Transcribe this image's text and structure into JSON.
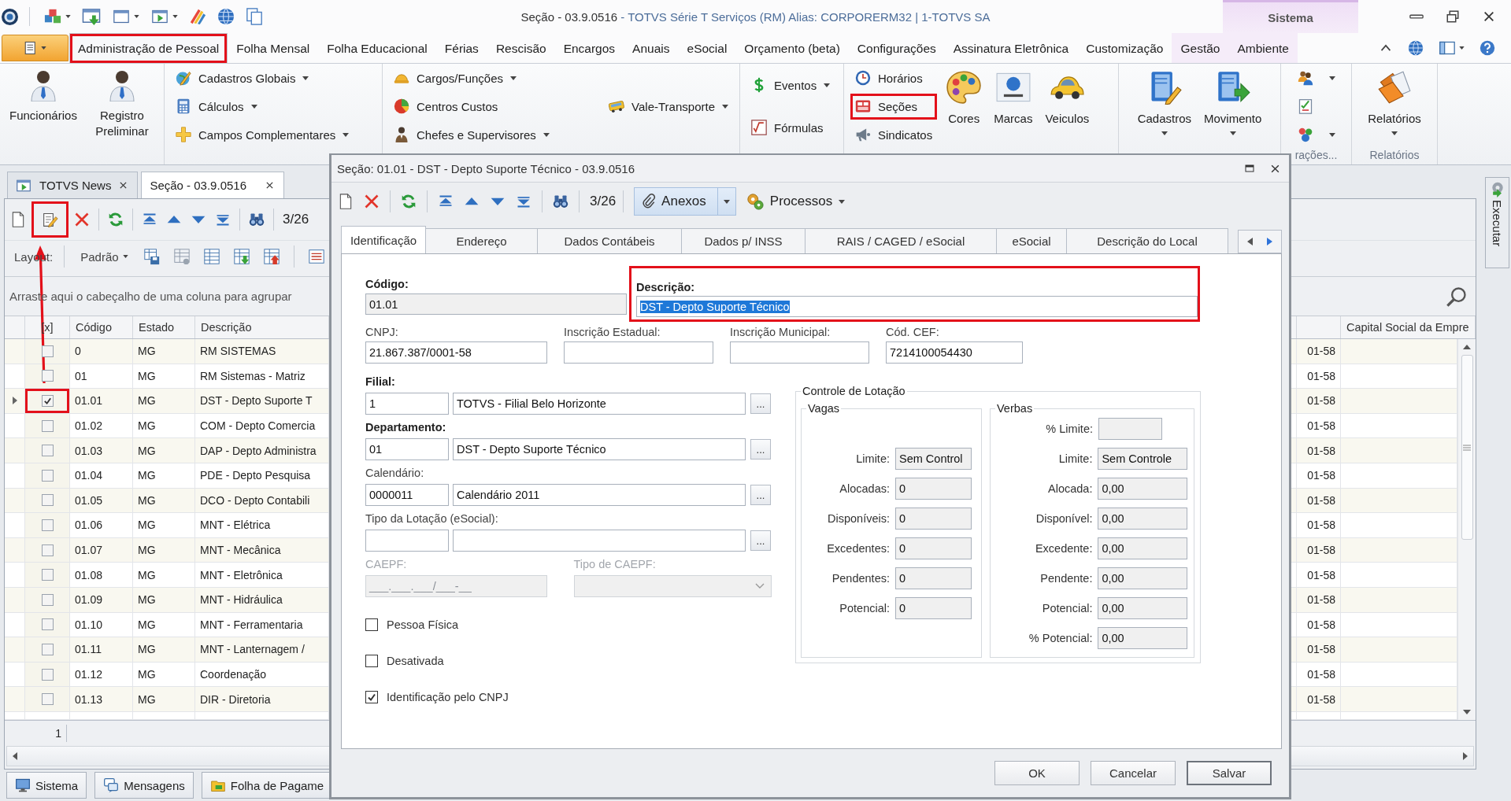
{
  "window": {
    "title": "Seção - 03.9.0516",
    "title_detail": "- TOTVS Série T Serviços (RM) Alias: CORPORERM32 | 1-TOTVS SA",
    "context_tab": "Sistema"
  },
  "menu_tabs": [
    {
      "label": "Administração de Pessoal",
      "selected": true,
      "contextual": false,
      "highlighted": true
    },
    {
      "label": "Folha Mensal",
      "selected": false,
      "contextual": false,
      "highlighted": false
    },
    {
      "label": "Folha Educacional",
      "selected": false,
      "contextual": false,
      "highlighted": false
    },
    {
      "label": "Férias",
      "selected": false,
      "contextual": false,
      "highlighted": false
    },
    {
      "label": "Rescisão",
      "selected": false,
      "contextual": false,
      "highlighted": false
    },
    {
      "label": "Encargos",
      "selected": false,
      "contextual": false,
      "highlighted": false
    },
    {
      "label": "Anuais",
      "selected": false,
      "contextual": false,
      "highlighted": false
    },
    {
      "label": "eSocial",
      "selected": false,
      "contextual": false,
      "highlighted": false
    },
    {
      "label": "Orçamento (beta)",
      "selected": false,
      "contextual": false,
      "highlighted": false
    },
    {
      "label": "Configurações",
      "selected": false,
      "contextual": false,
      "highlighted": false
    },
    {
      "label": "Assinatura Eletrônica",
      "selected": false,
      "contextual": false,
      "highlighted": false
    },
    {
      "label": "Customização",
      "selected": false,
      "contextual": false,
      "highlighted": false
    },
    {
      "label": "Gestão",
      "selected": false,
      "contextual": true,
      "highlighted": false
    },
    {
      "label": "Ambiente",
      "selected": false,
      "contextual": true,
      "highlighted": false
    }
  ],
  "ribbon": {
    "groups": [
      {
        "blocks": [
          {
            "kind": "large",
            "label": "Funcionários",
            "dropdown": false,
            "highlighted": false
          },
          {
            "kind": "large",
            "label": "Registro Preliminar",
            "dropdown": false,
            "highlighted": false
          }
        ]
      },
      {
        "blocks": [
          {
            "kind": "stack",
            "items": [
              {
                "label": "Cadastros Globais",
                "dropdown": true,
                "highlighted": false
              },
              {
                "label": "Cálculos",
                "dropdown": true,
                "highlighted": false
              },
              {
                "label": "Campos Complementares",
                "dropdown": true,
                "highlighted": false
              }
            ]
          }
        ]
      },
      {
        "blocks": [
          {
            "kind": "stack",
            "items": [
              {
                "label": "Cargos/Funções",
                "dropdown": true,
                "highlighted": false
              },
              {
                "label": "Centros Custos",
                "dropdown": false,
                "highlighted": false
              },
              {
                "label": "Chefes e Supervisores",
                "dropdown": true,
                "highlighted": false
              }
            ]
          },
          {
            "kind": "stack",
            "items": [
              {
                "label": "Vale-Transporte",
                "dropdown": true,
                "highlighted": false
              }
            ]
          }
        ]
      },
      {
        "blocks": [
          {
            "kind": "stack",
            "items": [
              {
                "label": "Eventos",
                "dropdown": true,
                "highlighted": false
              },
              {
                "label": "Fórmulas",
                "dropdown": false,
                "highlighted": false
              }
            ]
          }
        ]
      },
      {
        "blocks": [
          {
            "kind": "stack",
            "items": [
              {
                "label": "Horários",
                "dropdown": false,
                "highlighted": false
              },
              {
                "label": "Seções",
                "dropdown": false,
                "highlighted": true
              },
              {
                "label": "Sindicatos",
                "dropdown": false,
                "highlighted": false
              }
            ]
          },
          {
            "kind": "large",
            "label": "Cores",
            "dropdown": false,
            "highlighted": false
          },
          {
            "kind": "large",
            "label": "Marcas",
            "dropdown": false,
            "highlighted": false
          },
          {
            "kind": "large",
            "label": "Veiculos",
            "dropdown": false,
            "highlighted": false
          }
        ]
      },
      {
        "blocks": [
          {
            "kind": "large",
            "label": "Cadastros",
            "dropdown": true,
            "highlighted": false
          },
          {
            "kind": "large",
            "label": "Movimento",
            "dropdown": true,
            "highlighted": false
          }
        ]
      },
      {
        "label": "rações...",
        "blocks": [
          {
            "kind": "icons",
            "items": [
              {
                "dropdown": true
              },
              {
                "dropdown": false
              },
              {
                "dropdown": true
              }
            ]
          }
        ]
      },
      {
        "label": "Relatórios",
        "blocks": [
          {
            "kind": "large",
            "label": "Relatórios",
            "dropdown": true,
            "highlighted": false
          }
        ]
      }
    ]
  },
  "document_tabs": [
    {
      "label": "TOTVS News",
      "selected": false
    },
    {
      "label": "Seção - 03.9.0516",
      "selected": true
    }
  ],
  "toolbar": {
    "buttons": [
      {
        "kind": "new",
        "highlighted": false
      },
      {
        "kind": "edit",
        "highlighted": true
      },
      {
        "kind": "delete",
        "highlighted": false
      },
      {
        "kind": "refresh",
        "highlighted": false
      },
      {
        "kind": "first",
        "highlighted": false
      },
      {
        "kind": "previous",
        "highlighted": false
      },
      {
        "kind": "next",
        "highlighted": false
      },
      {
        "kind": "last",
        "highlighted": false
      },
      {
        "kind": "find",
        "highlighted": false
      }
    ],
    "counter": "3/26"
  },
  "layout_bar": {
    "label": "Layout:",
    "preset": "Padrão"
  },
  "group_panel": {
    "hint": "Arraste aqui o cabeçalho de uma coluna para agrupar"
  },
  "grid": {
    "columns": [
      "[x]",
      "Código",
      "Estado",
      "Descrição"
    ],
    "last_column": "Capital Social da Empre",
    "rows": [
      {
        "current": false,
        "checked": false,
        "highlighted": false,
        "code": "0",
        "state": "MG",
        "description": "RM SISTEMAS",
        "partial_column": "01-58"
      },
      {
        "current": false,
        "checked": false,
        "highlighted": false,
        "code": "01",
        "state": "MG",
        "description": "RM Sistemas - Matriz",
        "partial_column": "01-58"
      },
      {
        "current": true,
        "checked": true,
        "highlighted": true,
        "code": "01.01",
        "state": "MG",
        "description": "DST - Depto Suporte T",
        "partial_column": "01-58"
      },
      {
        "current": false,
        "checked": false,
        "highlighted": false,
        "code": "01.02",
        "state": "MG",
        "description": "COM - Depto Comercia",
        "partial_column": "01-58"
      },
      {
        "current": false,
        "checked": false,
        "highlighted": false,
        "code": "01.03",
        "state": "MG",
        "description": "DAP - Depto Administra",
        "partial_column": "01-58"
      },
      {
        "current": false,
        "checked": false,
        "highlighted": false,
        "code": "01.04",
        "state": "MG",
        "description": "PDE - Depto Pesquisa",
        "partial_column": "01-58"
      },
      {
        "current": false,
        "checked": false,
        "highlighted": false,
        "code": "01.05",
        "state": "MG",
        "description": "DCO - Depto Contabili",
        "partial_column": "01-58"
      },
      {
        "current": false,
        "checked": false,
        "highlighted": false,
        "code": "01.06",
        "state": "MG",
        "description": "MNT - Elétrica",
        "partial_column": "01-58"
      },
      {
        "current": false,
        "checked": false,
        "highlighted": false,
        "code": "01.07",
        "state": "MG",
        "description": "MNT - Mecânica",
        "partial_column": "01-58"
      },
      {
        "current": false,
        "checked": false,
        "highlighted": false,
        "code": "01.08",
        "state": "MG",
        "description": "MNT - Eletrônica",
        "partial_column": "01-58"
      },
      {
        "current": false,
        "checked": false,
        "highlighted": false,
        "code": "01.09",
        "state": "MG",
        "description": "MNT - Hidráulica",
        "partial_column": "01-58"
      },
      {
        "current": false,
        "checked": false,
        "highlighted": false,
        "code": "01.10",
        "state": "MG",
        "description": "MNT - Ferramentaria",
        "partial_column": "01-58"
      },
      {
        "current": false,
        "checked": false,
        "highlighted": false,
        "code": "01.11",
        "state": "MG",
        "description": "MNT - Lanternagem /",
        "partial_column": "01-58"
      },
      {
        "current": false,
        "checked": false,
        "highlighted": false,
        "code": "01.12",
        "state": "MG",
        "description": "Coordenação",
        "partial_column": "01-58"
      },
      {
        "current": false,
        "checked": false,
        "highlighted": false,
        "code": "01.13",
        "state": "MG",
        "description": "DIR - Diretoria",
        "partial_column": "01-58"
      }
    ],
    "footer": "1"
  },
  "taskbar": [
    {
      "label": "Sistema"
    },
    {
      "label": "Mensagens"
    },
    {
      "label": "Folha de Pagame"
    }
  ],
  "side_panel": {
    "label": "Executar"
  },
  "dialog": {
    "title": "Seção: 01.01 - DST - Depto Suporte Técnico - 03.9.0516",
    "toolbar": {
      "buttons": [
        {
          "kind": "new"
        },
        {
          "kind": "delete"
        },
        {
          "kind": "refresh"
        },
        {
          "kind": "first"
        },
        {
          "kind": "previous"
        },
        {
          "kind": "next"
        },
        {
          "kind": "last"
        },
        {
          "kind": "find"
        }
      ],
      "counter": "3/26",
      "attachments": "Anexos",
      "processes": "Processos"
    },
    "tabs": [
      {
        "label": "Identificação",
        "selected": true
      },
      {
        "label": "Endereço",
        "selected": false
      },
      {
        "label": "Dados Contábeis",
        "selected": false
      },
      {
        "label": "Dados p/ INSS",
        "selected": false
      },
      {
        "label": "RAIS / CAGED / eSocial",
        "selected": false
      },
      {
        "label": "eSocial",
        "selected": false
      },
      {
        "label": "Descrição do Local",
        "selected": false
      }
    ],
    "code": {
      "label": "Código:",
      "value": "01.01",
      "readonly": true
    },
    "description": {
      "label": "Descrição:",
      "value": "DST - Depto Suporte Técnico",
      "highlighted": true,
      "text_selected": true
    },
    "id_fields": [
      {
        "label": "CNPJ:",
        "value": "21.867.387/0001-58"
      },
      {
        "label": "Inscrição Estadual:"
      },
      {
        "label": "Inscrição Municipal:"
      },
      {
        "label": "Cód. CEF:",
        "value": "7214100054430"
      }
    ],
    "lookups": [
      {
        "label": "Filial:",
        "required": true,
        "code": "1",
        "name": "TOTVS - Filial Belo Horizonte",
        "browse": "..."
      },
      {
        "label": "Departamento:",
        "required": true,
        "code": "01",
        "name": "DST - Depto Suporte Técnico",
        "browse": "..."
      },
      {
        "label": "Calendário:",
        "required": false,
        "code": "0000011",
        "name": "Calendário 2011",
        "browse": "..."
      },
      {
        "label": "Tipo da Lotação (eSocial):",
        "required": false,
        "browse": "..."
      }
    ],
    "caepf": {
      "label": "CAEPF:",
      "placeholder": "___.___.___/___-__",
      "disabled": true
    },
    "caepf_type": {
      "label": "Tipo de CAEPF:",
      "disabled": true
    },
    "checkboxes": [
      {
        "label": "Pessoa Física",
        "checked": false
      },
      {
        "label": "Desativada",
        "checked": false
      },
      {
        "label": "Identificação pelo CNPJ",
        "checked": true
      }
    ],
    "allocation": {
      "title": "Controle de Lotação",
      "vacancies": {
        "title": "Vagas",
        "rows": [
          {
            "label": "Limite:",
            "value": "Sem Control",
            "readonly": true
          },
          {
            "label": "Alocadas:",
            "value": "0",
            "readonly": true
          },
          {
            "label": "Disponíveis:",
            "value": "0",
            "readonly": true
          },
          {
            "label": "Excedentes:",
            "value": "0",
            "readonly": true
          },
          {
            "label": "Pendentes:",
            "value": "0",
            "readonly": true
          },
          {
            "label": "Potencial:",
            "value": "0",
            "readonly": true
          }
        ]
      },
      "budget": {
        "title": "Verbas",
        "rows": [
          {
            "label": "% Limite:",
            "readonly": true
          },
          {
            "label": "Limite:",
            "value": "Sem Controle",
            "readonly": true
          },
          {
            "label": "Alocada:",
            "value": "0,00",
            "readonly": true
          },
          {
            "label": "Disponível:",
            "value": "0,00",
            "readonly": true
          },
          {
            "label": "Excedente:",
            "value": "0,00",
            "readonly": true
          },
          {
            "label": "Pendente:",
            "value": "0,00",
            "readonly": true
          },
          {
            "label": "Potencial:",
            "value": "0,00",
            "readonly": true
          },
          {
            "label": "% Potencial:",
            "value": "0,00",
            "readonly": true
          }
        ]
      }
    },
    "buttons": [
      {
        "label": "OK",
        "default": false
      },
      {
        "label": "Cancelar",
        "default": false
      },
      {
        "label": "Salvar",
        "default": true
      }
    ]
  }
}
